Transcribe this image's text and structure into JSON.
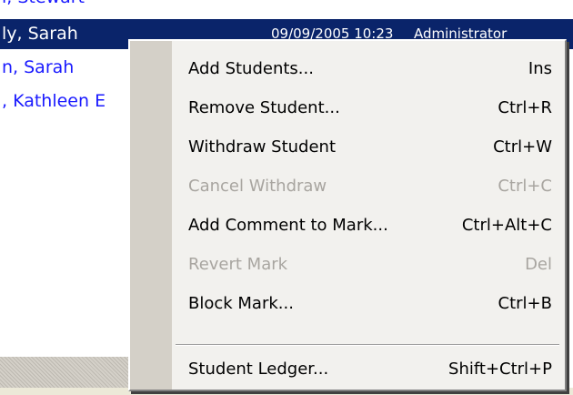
{
  "list": {
    "partial_top": "l, Stewart",
    "rows": [
      {
        "name": "ly, Sarah",
        "date": "09/09/2005 10:23",
        "user": "Administrator",
        "selected": true
      },
      {
        "name": "n, Sarah"
      },
      {
        "name": ", Kathleen E"
      }
    ]
  },
  "menu": {
    "items": [
      {
        "label": "Add Students...",
        "shortcut": "Ins",
        "enabled": true
      },
      {
        "label": "Remove Student...",
        "shortcut": "Ctrl+R",
        "enabled": true
      },
      {
        "label": "Withdraw Student",
        "shortcut": "Ctrl+W",
        "enabled": true
      },
      {
        "label": "Cancel Withdraw",
        "shortcut": "Ctrl+C",
        "enabled": false
      },
      {
        "label": "Add Comment to Mark...",
        "shortcut": "Ctrl+Alt+C",
        "enabled": true
      },
      {
        "label": "Revert Mark",
        "shortcut": "Del",
        "enabled": false
      },
      {
        "label": "Block Mark...",
        "shortcut": "Ctrl+B",
        "enabled": true
      },
      {
        "label": "Student Ledger...",
        "shortcut": "Shift+Ctrl+P",
        "enabled": true
      }
    ]
  }
}
